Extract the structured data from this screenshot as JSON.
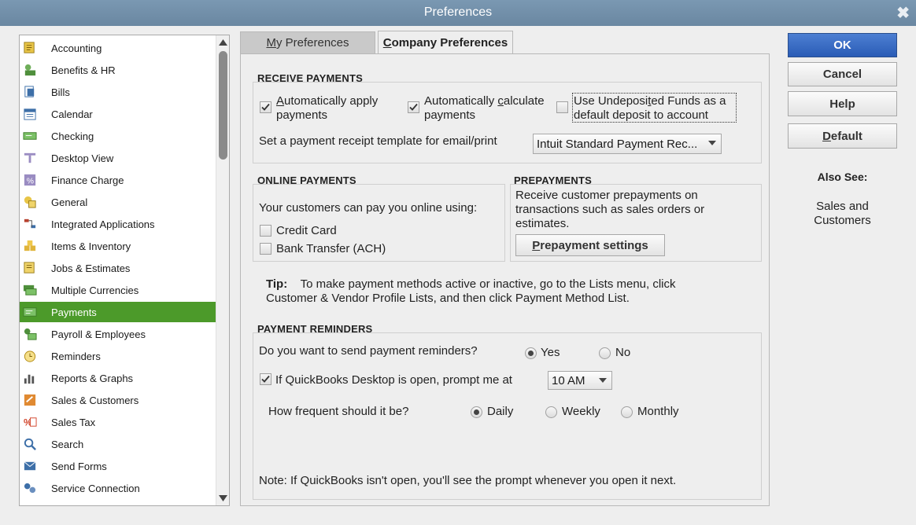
{
  "window": {
    "title": "Preferences",
    "close_glyph": "✖"
  },
  "categories": [
    {
      "label": "Accounting",
      "icon": "accounting-icon"
    },
    {
      "label": "Benefits & HR",
      "icon": "benefits-icon"
    },
    {
      "label": "Bills",
      "icon": "bills-icon"
    },
    {
      "label": "Calendar",
      "icon": "calendar-icon"
    },
    {
      "label": "Checking",
      "icon": "checking-icon"
    },
    {
      "label": "Desktop View",
      "icon": "desktop-view-icon"
    },
    {
      "label": "Finance Charge",
      "icon": "finance-charge-icon"
    },
    {
      "label": "General",
      "icon": "general-icon"
    },
    {
      "label": "Integrated Applications",
      "icon": "integrated-apps-icon"
    },
    {
      "label": "Items & Inventory",
      "icon": "items-inventory-icon"
    },
    {
      "label": "Jobs & Estimates",
      "icon": "jobs-estimates-icon"
    },
    {
      "label": "Multiple Currencies",
      "icon": "currencies-icon"
    },
    {
      "label": "Payments",
      "icon": "payments-icon",
      "selected": true
    },
    {
      "label": "Payroll & Employees",
      "icon": "payroll-icon"
    },
    {
      "label": "Reminders",
      "icon": "reminders-icon"
    },
    {
      "label": "Reports & Graphs",
      "icon": "reports-icon"
    },
    {
      "label": "Sales & Customers",
      "icon": "sales-customers-icon"
    },
    {
      "label": "Sales Tax",
      "icon": "sales-tax-icon"
    },
    {
      "label": "Search",
      "icon": "search-icon"
    },
    {
      "label": "Send Forms",
      "icon": "send-forms-icon"
    },
    {
      "label": "Service Connection",
      "icon": "service-connection-icon"
    }
  ],
  "tabs": {
    "my_prefix": "M",
    "my_rest": "y Preferences",
    "company_prefix": "C",
    "company_rest": "ompany Preferences"
  },
  "receive": {
    "header": "RECEIVE PAYMENTS",
    "auto_apply": {
      "p1": "A",
      "p2": "utomatically apply",
      "p3": "payments",
      "checked": true
    },
    "auto_calc": {
      "p1": "Automatically ",
      "p2": "c",
      "p3": "alculate",
      "p4": "payments",
      "checked": true
    },
    "undeposited": {
      "p1": "Use Undeposi",
      "p2": "t",
      "p3": "ed Funds as a",
      "p4": "default deposit to account",
      "checked": false
    },
    "template_label": "Set a payment receipt template for email/print",
    "template_value": "Intuit Standard Payment Rec..."
  },
  "online": {
    "header": "ONLINE PAYMENTS",
    "intro": "Your customers can pay you online using:",
    "credit_card": "Credit Card",
    "ach": "Bank Transfer (ACH)"
  },
  "prepay": {
    "header": "PREPAYMENTS",
    "line1": "Receive customer prepayments on",
    "line2": "transactions such as sales orders or",
    "line3": "estimates.",
    "btn_p1": "P",
    "btn_p2": "repayment settings"
  },
  "tip": {
    "label": "Tip:",
    "line1": "To make payment methods active or inactive, go to the Lists menu, click",
    "line2": "Customer & Vendor Profile Lists, and then click Payment Method List."
  },
  "reminders": {
    "header": "PAYMENT REMINDERS",
    "question": "Do you want to send payment reminders?",
    "yes": "Yes",
    "no": "No",
    "prompt_label": "If QuickBooks Desktop is open, prompt me at",
    "prompt_checked": true,
    "time": "10 AM",
    "freq_label": "How frequent should it be?",
    "daily": "Daily",
    "weekly": "Weekly",
    "monthly": "Monthly",
    "note": "Note: If QuickBooks isn't open, you'll see the prompt whenever you open it next."
  },
  "buttons": {
    "ok": "OK",
    "cancel": "Cancel",
    "help": "Help",
    "default_p1": "D",
    "default_p2": "efault"
  },
  "also_see": {
    "title": "Also See:",
    "line1": "Sales and",
    "line2": "Customers"
  },
  "colors": {
    "titlebar": "#7090aa",
    "selected": "#4c9a2a",
    "ok_button": "#2f62ba"
  }
}
